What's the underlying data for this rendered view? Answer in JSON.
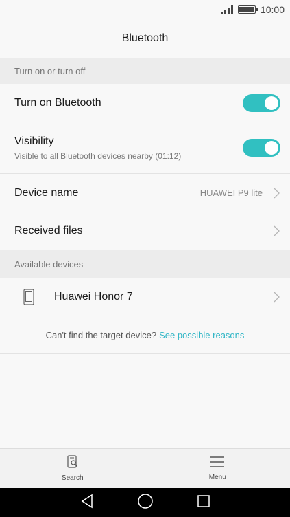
{
  "status_bar": {
    "time": "10:00",
    "signal_icon": "signal-icon",
    "battery_icon": "battery-icon"
  },
  "header": {
    "title": "Bluetooth"
  },
  "sections": {
    "toggle_section": {
      "label": "Turn on or turn off"
    },
    "available_section": {
      "label": "Available devices"
    }
  },
  "rows": {
    "bluetooth": {
      "title": "Turn on Bluetooth",
      "state": "on"
    },
    "visibility": {
      "title": "Visibility",
      "subtitle": "Visible to all Bluetooth devices nearby (01:12)",
      "state": "on"
    },
    "device_name": {
      "title": "Device name",
      "value": "HUAWEI P9 lite"
    },
    "received_files": {
      "title": "Received files"
    }
  },
  "devices": [
    {
      "name": "Huawei Honor 7",
      "icon": "phone-icon"
    }
  ],
  "hint": {
    "text": "Can't find the target device?",
    "link": "See possible reasons"
  },
  "action_bar": {
    "search_label": "Search",
    "menu_label": "Menu"
  },
  "colors": {
    "accent": "#31c0c1",
    "link": "#31b6c6"
  }
}
